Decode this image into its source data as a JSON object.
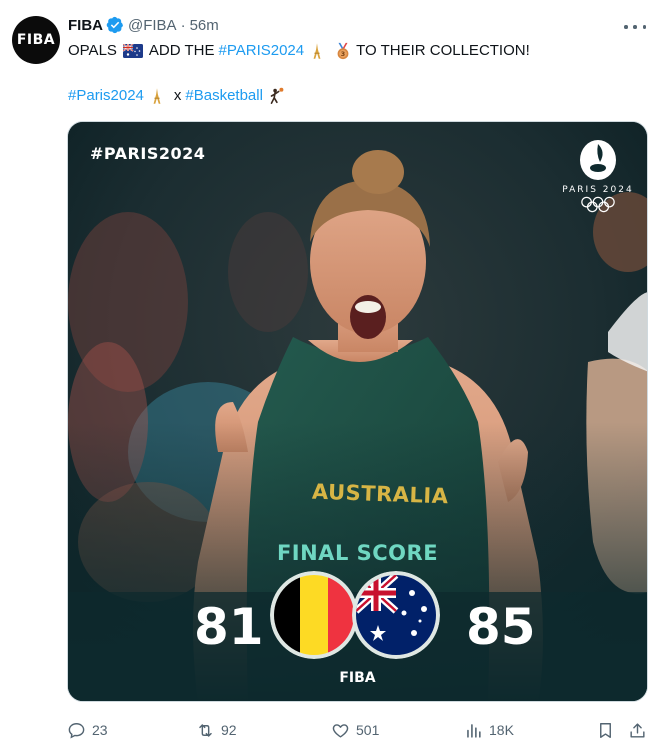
{
  "account": {
    "name": "FIBA",
    "avatar_text": "FIBA",
    "handle": "@FIBA",
    "separator": "·",
    "time": "56m"
  },
  "tweet": {
    "line1_pre": "OPALS",
    "line1_mid": "ADD THE",
    "hashtag1": "#PARIS2024",
    "line1_post": "TO THEIR COLLECTION!",
    "hashtag2": "#Paris2024",
    "line2_x": "x",
    "hashtag3": "#Basketball"
  },
  "media": {
    "overlay_hashtag": "#PARIS2024",
    "logo_text": "PARIS 2024",
    "jersey_text": "AUSTRALIA",
    "final_label": "FINAL SCORE",
    "score_left": "81",
    "score_right": "85",
    "left_team_flag": "belgium-flag",
    "right_team_flag": "australia-flag",
    "brand": "FIBA"
  },
  "actions": {
    "replies": "23",
    "reposts": "92",
    "likes": "501",
    "views": "18K"
  },
  "colors": {
    "link": "#1d9bf0",
    "secondary": "#536471",
    "final_score": "#6fd7c2",
    "jersey": "#1f4d43"
  }
}
